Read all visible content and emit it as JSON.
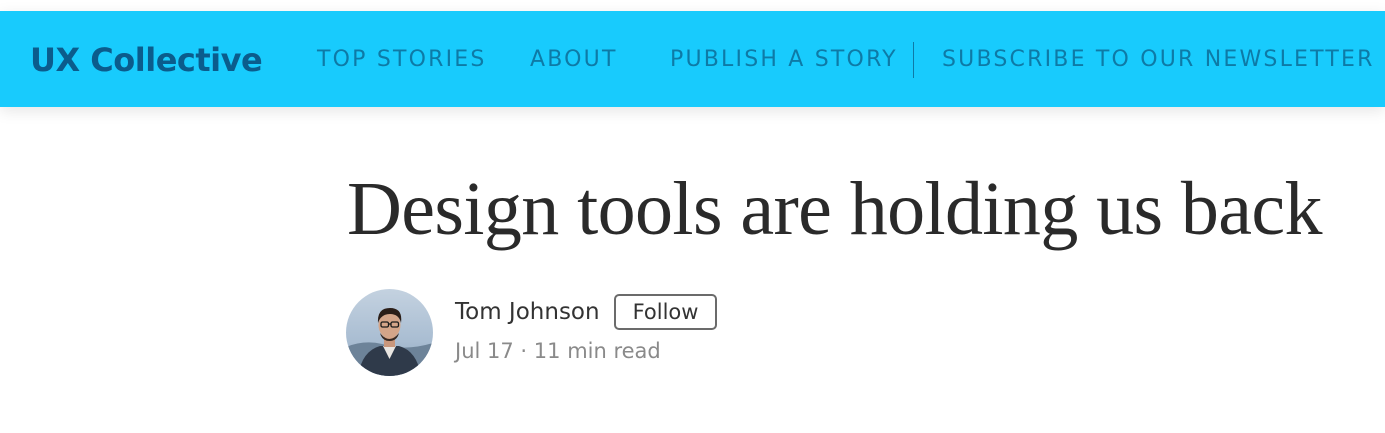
{
  "header": {
    "brand": "UX Collective",
    "nav": [
      {
        "label": "TOP STORIES"
      },
      {
        "label": "ABOUT"
      },
      {
        "label": "PUBLISH A STORY"
      },
      {
        "label": "SUBSCRIBE TO OUR NEWSLETTER"
      }
    ]
  },
  "article": {
    "title": "Design tools are holding us back",
    "author": {
      "name": "Tom Johnson",
      "follow_label": "Follow",
      "avatar_icon": "author-avatar-photo"
    },
    "date": "Jul 17",
    "separator": "·",
    "read_time": "11 min read"
  },
  "colors": {
    "header_bg": "#18cbfd",
    "brand_text": "#0b5c8c",
    "nav_text": "#0e7aa6",
    "divider": "#0e7aa6",
    "title_text": "#2a2a2a",
    "author_text": "#333333",
    "meta_text": "#8a8a8a",
    "follow_border": "#6b6b6b",
    "follow_text": "#333333"
  }
}
